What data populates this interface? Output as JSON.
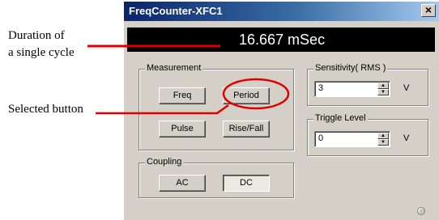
{
  "annotations": {
    "duration": "Duration of\na single cycle",
    "selected_button": "Selected button"
  },
  "window": {
    "title": "FreqCounter-XFC1",
    "close_glyph": "×"
  },
  "display": {
    "readout": "16.667 mSec"
  },
  "measurement": {
    "legend": "Measurement",
    "freq_label": "Freq",
    "period_label": "Period",
    "pulse_label": "Pulse",
    "risefall_label": "Rise/Fall",
    "selected": "Period"
  },
  "coupling": {
    "legend": "Coupling",
    "ac_label": "AC",
    "dc_label": "DC",
    "selected": "DC"
  },
  "sensitivity": {
    "legend": "Sensitivity( RMS )",
    "value": "3",
    "unit": "V"
  },
  "trigger": {
    "legend": "Triggle Level",
    "value": "0",
    "unit": "V"
  },
  "colors": {
    "callout_red": "#e00000",
    "titlebar_start": "#0a246a",
    "titlebar_end": "#a6caf0",
    "window_bg": "#d4d0c8",
    "display_bg": "#000000",
    "display_text": "#ffffff"
  }
}
